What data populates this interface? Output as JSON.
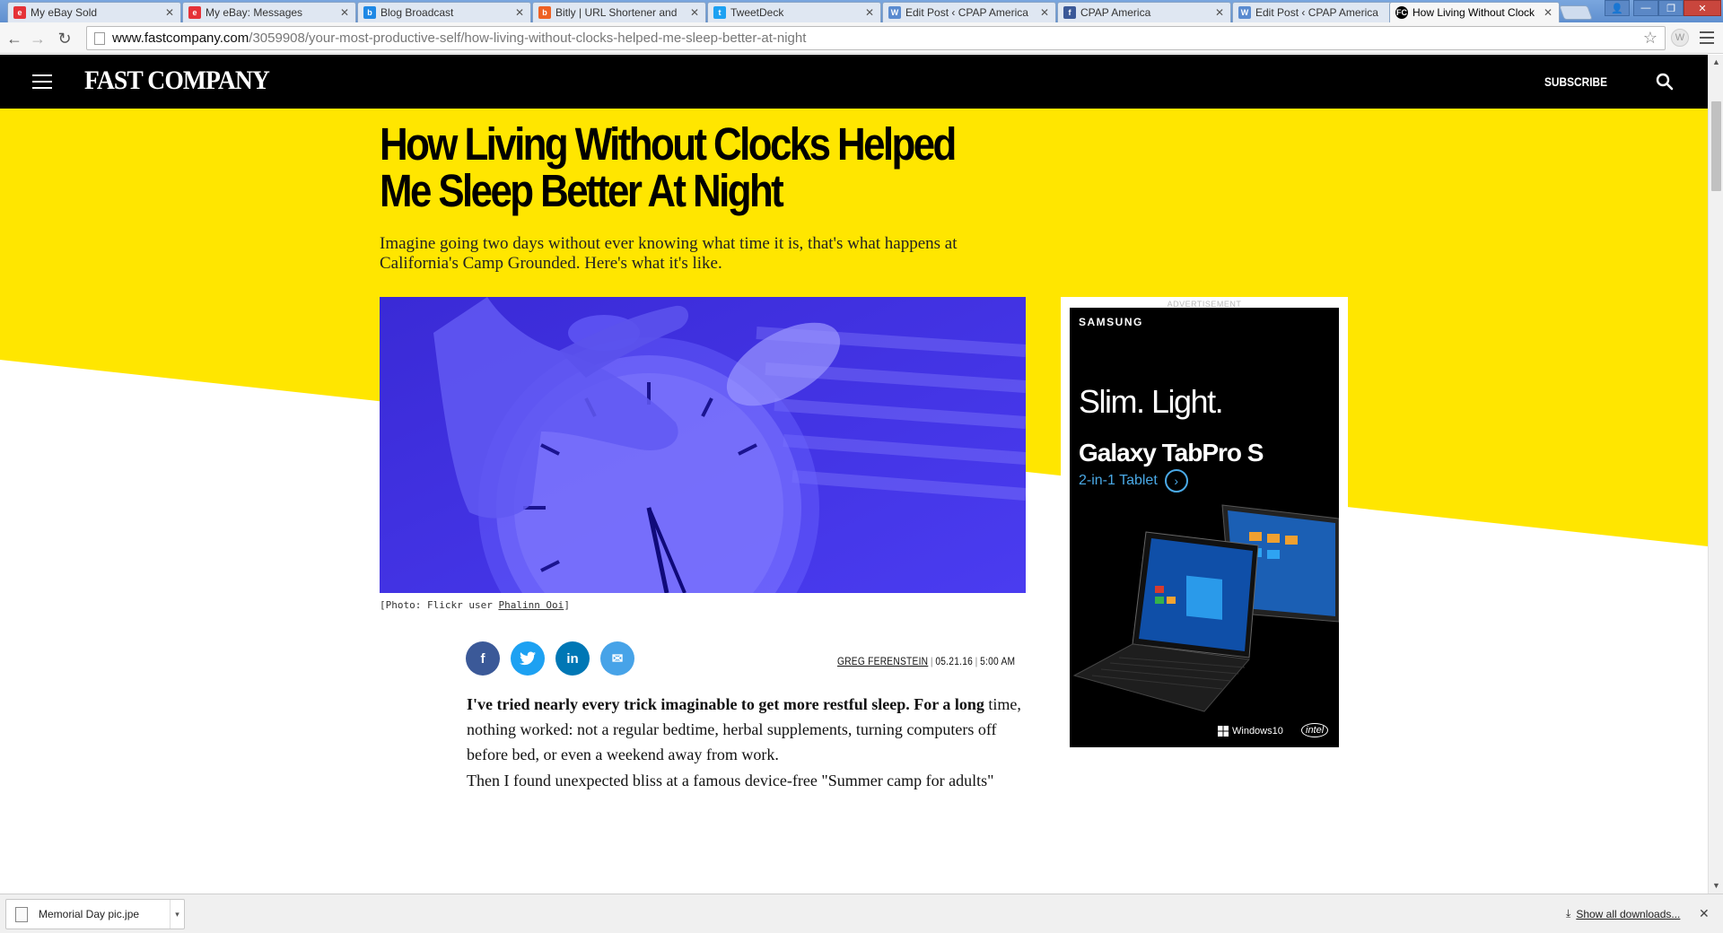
{
  "browser": {
    "tabs": [
      {
        "label": "My eBay Sold",
        "favicon": "ebay-icon",
        "color": "#e53238"
      },
      {
        "label": "My eBay: Messages",
        "favicon": "ebay-icon",
        "color": "#e53238"
      },
      {
        "label": "Blog Broadcast",
        "favicon": "blog-broadcast-icon",
        "color": "#1e88e5"
      },
      {
        "label": "Bitly | URL Shortener and",
        "favicon": "bitly-icon",
        "color": "#ee6123"
      },
      {
        "label": "TweetDeck",
        "favicon": "tweetdeck-icon",
        "color": "#1da1f2"
      },
      {
        "label": "Edit Post ‹ CPAP America",
        "favicon": "wordpress-icon",
        "color": "#5a8bd0"
      },
      {
        "label": "CPAP America",
        "favicon": "facebook-icon",
        "color": "#3b5998"
      },
      {
        "label": "Edit Post ‹ CPAP America",
        "favicon": "wordpress-icon",
        "color": "#5a8bd0"
      },
      {
        "label": "How Living Without Clock",
        "favicon": "fastcompany-icon",
        "color": "#000000"
      }
    ],
    "url_host": "www.fastcompany.com",
    "url_path": "/3059908/your-most-productive-self/how-living-without-clocks-helped-me-sleep-better-at-night",
    "ext_letter": "W"
  },
  "site": {
    "logo": "FAST COMPANY",
    "subscribe": "SUBSCRIBE"
  },
  "article": {
    "headline": "How Living Without Clocks Helped Me Sleep Better At Night",
    "dek": "Imagine going two days without ever knowing what time it is, that's what happens at California's Camp Grounded. Here's what it's like.",
    "caption_prefix": "[Photo: Flickr user ",
    "caption_credit": "Phalinn Ooi",
    "caption_suffix": "]",
    "author": "GREG FERENSTEIN",
    "date": "05.21.16",
    "time": "5:00 AM",
    "p1_lead": "I've tried nearly every trick imaginable to get more restful sleep. For a long",
    "p1_rest": "time, nothing worked: not a regular bedtime, herbal supplements, turning computers off before bed, or even a weekend away from work.",
    "p2": "Then I found unexpected bliss at a famous device-free \"Summer camp for adults\"",
    "share": [
      {
        "label": "f",
        "name": "facebook-share-button",
        "color": "#3b5998"
      },
      {
        "label": "t",
        "name": "twitter-share-button",
        "color": "#1da1f2"
      },
      {
        "label": "in",
        "name": "linkedin-share-button",
        "color": "#0077b5"
      },
      {
        "label": "✉",
        "name": "email-share-button",
        "color": "#47a3e8"
      }
    ]
  },
  "ad": {
    "label": "ADVERTISEMENT",
    "brand": "SAMSUNG",
    "tagline": "Slim. Light.",
    "product": "Galaxy TabPro S",
    "sub": "2-in-1 Tablet",
    "os": "Windows10",
    "chip": "intel"
  },
  "downloads": {
    "file": "Memorial Day pic.jpe",
    "show_all": "Show all downloads..."
  },
  "colors": {
    "hero_yellow": "#ffe600",
    "header_black": "#000000",
    "image_tint": "#3c2fd9"
  }
}
